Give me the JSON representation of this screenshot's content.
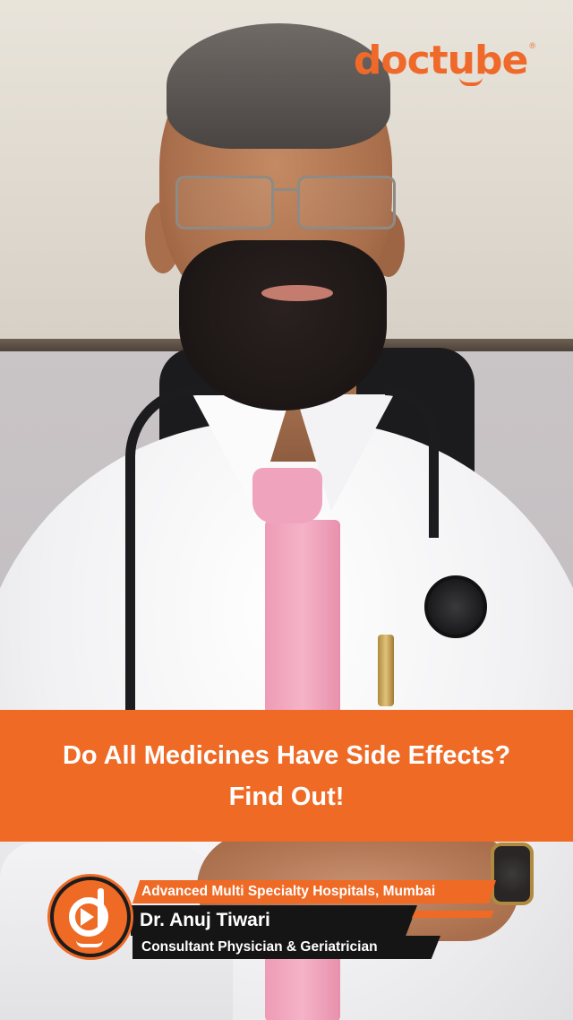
{
  "brand": {
    "logo_text": "doctube",
    "registered_mark": "®",
    "accent_color": "#ef6a25"
  },
  "video": {
    "title_line_1": "Do All Medicines Have Side Effects?",
    "title_line_2": "Find Out!"
  },
  "doctor": {
    "hospital": "Advanced Multi Specialty Hospitals, Mumbai",
    "name": "Dr. Anuj Tiwari",
    "role": "Consultant Physician & Geriatrician",
    "badge_icon": "doctube-play-badge-icon"
  }
}
